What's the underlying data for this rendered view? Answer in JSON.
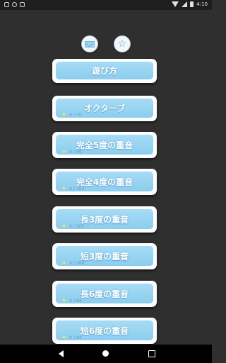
{
  "status_bar": {
    "time": "4:10"
  },
  "top_icons": [
    {
      "icon": "mail-icon"
    },
    {
      "icon": "star-icon"
    }
  ],
  "menu": [
    {
      "label": "遊び方",
      "score": ""
    },
    {
      "label": "オクターブ",
      "score": "0 / 75"
    },
    {
      "label": "完全5度の重音",
      "score": "0 / 99"
    },
    {
      "label": "完全4度の重音",
      "score": "0 / 102"
    },
    {
      "label": "長3度の重音",
      "score": "0 / 102"
    },
    {
      "label": "短3度の重音",
      "score": "0 / 108"
    },
    {
      "label": "長6度の重音",
      "score": "0 / 84"
    },
    {
      "label": "短6度の重音",
      "score": "0 / 84"
    }
  ],
  "colors": {
    "background": "#2f2f2f",
    "button_fill": "#9ed6f2",
    "button_border": "#fbfdfe",
    "score_star": "#f3e36a"
  }
}
